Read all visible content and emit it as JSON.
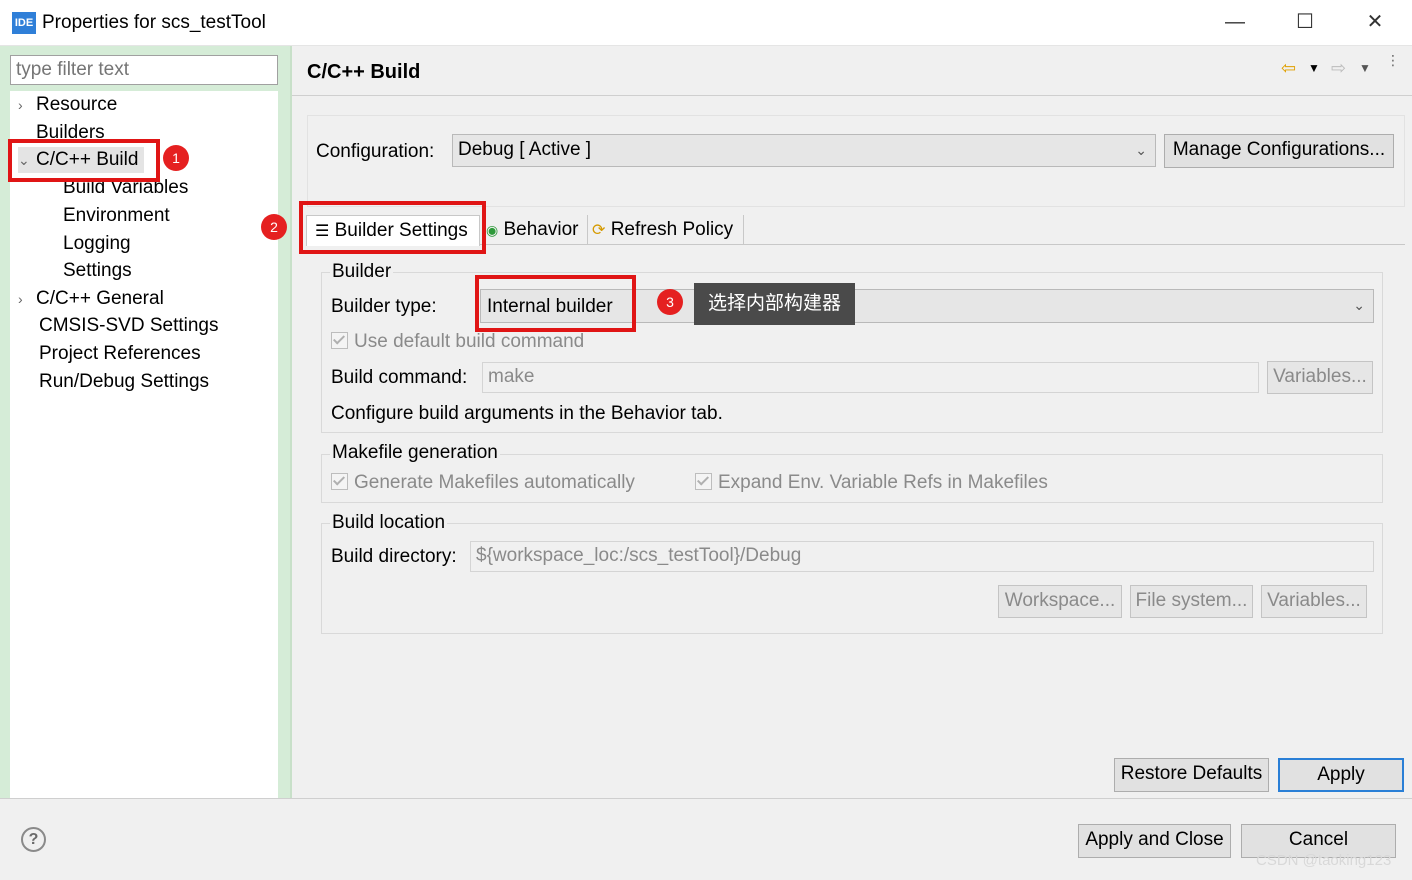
{
  "window": {
    "icon_text": "IDE",
    "title": "Properties for scs_testTool",
    "minimize": "—",
    "maximize": "☐",
    "close": "✕"
  },
  "left": {
    "filter_placeholder": "type filter text",
    "tree": [
      {
        "label": "Resource",
        "toggle": "›"
      },
      {
        "label": "Builders",
        "toggle": ""
      },
      {
        "label": "C/C++ Build",
        "toggle": "⌄"
      },
      {
        "label": "Build Variables",
        "toggle": ""
      },
      {
        "label": "Environment",
        "toggle": ""
      },
      {
        "label": "Logging",
        "toggle": ""
      },
      {
        "label": "Settings",
        "toggle": ""
      },
      {
        "label": "C/C++ General",
        "toggle": "›"
      },
      {
        "label": "CMSIS-SVD Settings",
        "toggle": ""
      },
      {
        "label": "Project References",
        "toggle": ""
      },
      {
        "label": "Run/Debug Settings",
        "toggle": ""
      }
    ]
  },
  "page": {
    "title": "C/C++ Build",
    "configuration_label": "Configuration:",
    "configuration_value": "Debug  [ Active ]",
    "manage_button": "Manage Configurations...",
    "tabs": [
      "Builder Settings",
      "Behavior",
      "Refresh Policy"
    ],
    "builder_group": "Builder",
    "builder_type_label": "Builder type:",
    "builder_type_value": "Internal builder",
    "use_default_label": "Use default build command",
    "build_command_label": "Build command:",
    "build_command_value": "make",
    "variables_button": "Variables...",
    "behavior_hint": "Configure build arguments in the Behavior tab.",
    "makefile_group": "Makefile generation",
    "gen_makefiles_label": "Generate Makefiles automatically",
    "expand_env_label": "Expand Env. Variable Refs in Makefiles",
    "location_group": "Build location",
    "build_dir_label": "Build directory:",
    "build_dir_value": "${workspace_loc:/scs_testTool}/Debug",
    "workspace_button": "Workspace...",
    "filesystem_button": "File system...",
    "variables_button_2": "Variables...",
    "restore_button": "Restore Defaults",
    "apply_button": "Apply"
  },
  "footer": {
    "help_icon": "?",
    "apply_close_button": "Apply and Close",
    "cancel_button": "Cancel",
    "watermark": "CSDN @taoking123"
  },
  "annotations": {
    "badge1": "1",
    "badge2": "2",
    "badge3": "3",
    "tooltip": "选择内部构建器",
    "color": "#e01515"
  }
}
